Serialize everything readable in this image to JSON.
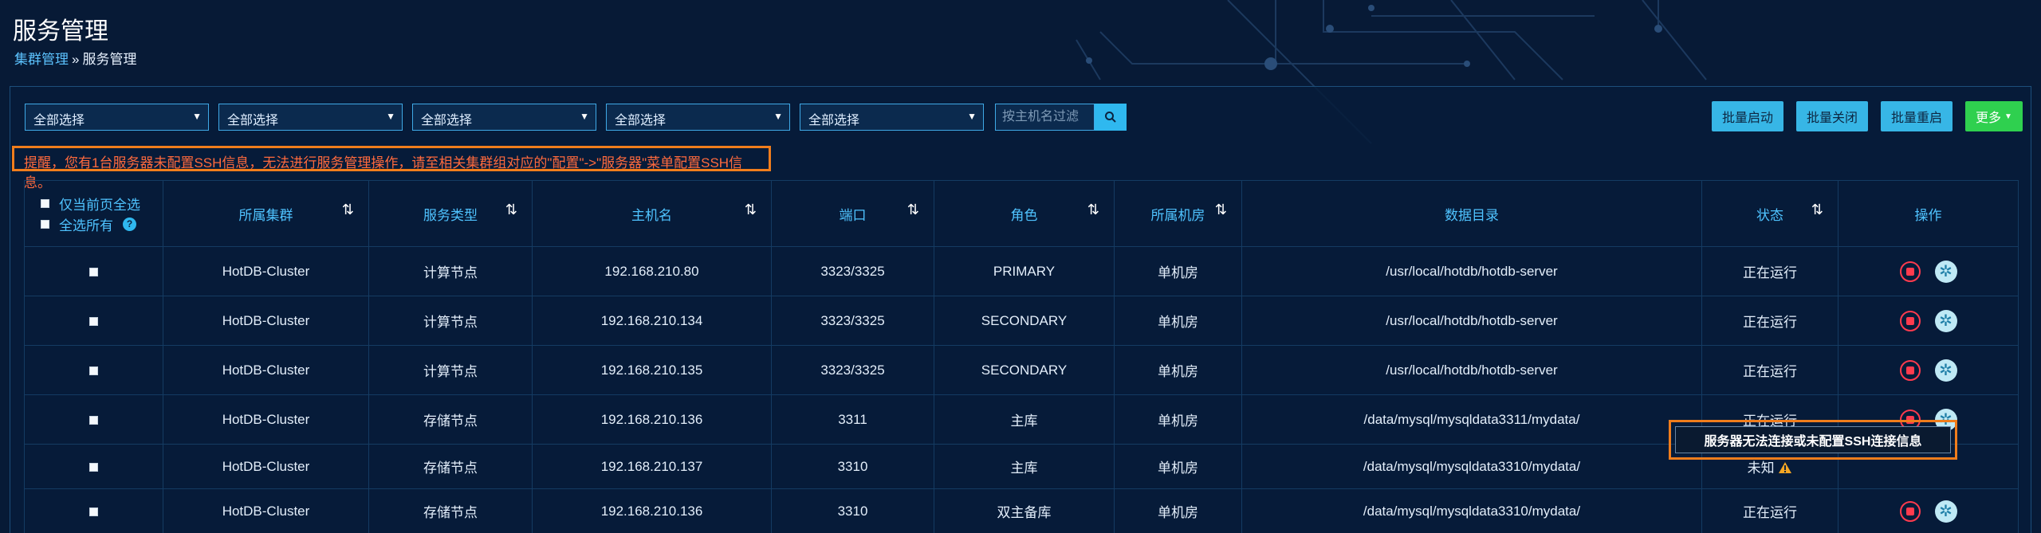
{
  "page": {
    "title": "服务管理"
  },
  "breadcrumb": {
    "parent": "集群管理",
    "separator": "»",
    "current": "服务管理"
  },
  "filters": {
    "selects": [
      "全部选择",
      "全部选择",
      "全部选择",
      "全部选择",
      "全部选择"
    ],
    "host_placeholder": "按主机名过滤"
  },
  "actions": {
    "batch_start": "批量启动",
    "batch_stop": "批量关闭",
    "batch_restart": "批量重启",
    "more": "更多"
  },
  "warning": "提醒，您有1台服务器未配置SSH信息，无法进行服务管理操作，请至相关集群组对应的\"配置\"->\"服务器\"菜单配置SSH信息。",
  "table": {
    "select_page": "仅当前页全选",
    "select_all": "全选所有",
    "columns": [
      "所属集群",
      "服务类型",
      "主机名",
      "端口",
      "角色",
      "所属机房",
      "数据目录",
      "状态",
      "操作"
    ],
    "rows": [
      {
        "cluster": "HotDB-Cluster",
        "type": "计算节点",
        "host": "192.168.210.80",
        "port": "3323/3325",
        "role": "PRIMARY",
        "room": "单机房",
        "dir": "/usr/local/hotdb/hotdb-server",
        "status": "正在运行"
      },
      {
        "cluster": "HotDB-Cluster",
        "type": "计算节点",
        "host": "192.168.210.134",
        "port": "3323/3325",
        "role": "SECONDARY",
        "room": "单机房",
        "dir": "/usr/local/hotdb/hotdb-server",
        "status": "正在运行"
      },
      {
        "cluster": "HotDB-Cluster",
        "type": "计算节点",
        "host": "192.168.210.135",
        "port": "3323/3325",
        "role": "SECONDARY",
        "room": "单机房",
        "dir": "/usr/local/hotdb/hotdb-server",
        "status": "正在运行"
      },
      {
        "cluster": "HotDB-Cluster",
        "type": "存储节点",
        "host": "192.168.210.136",
        "port": "3311",
        "role": "主库",
        "room": "单机房",
        "dir": "/data/mysql/mysqldata3311/mydata/",
        "status": "正在运行"
      },
      {
        "cluster": "HotDB-Cluster",
        "type": "存储节点",
        "host": "192.168.210.137",
        "port": "3310",
        "role": "主库",
        "room": "单机房",
        "dir": "/data/mysql/mysqldata3310/mydata/",
        "status": "未知"
      },
      {
        "cluster": "HotDB-Cluster",
        "type": "存储节点",
        "host": "192.168.210.136",
        "port": "3310",
        "role": "双主备库",
        "room": "单机房",
        "dir": "/data/mysql/mysqldata3310/mydata/",
        "status": "正在运行"
      }
    ]
  },
  "tooltip": "服务器无法连接或未配置SSH连接信息",
  "colors": {
    "accent": "#37b6e6",
    "running": "#35e05a",
    "danger": "#ff3b4e",
    "warning": "#f07d1c"
  }
}
